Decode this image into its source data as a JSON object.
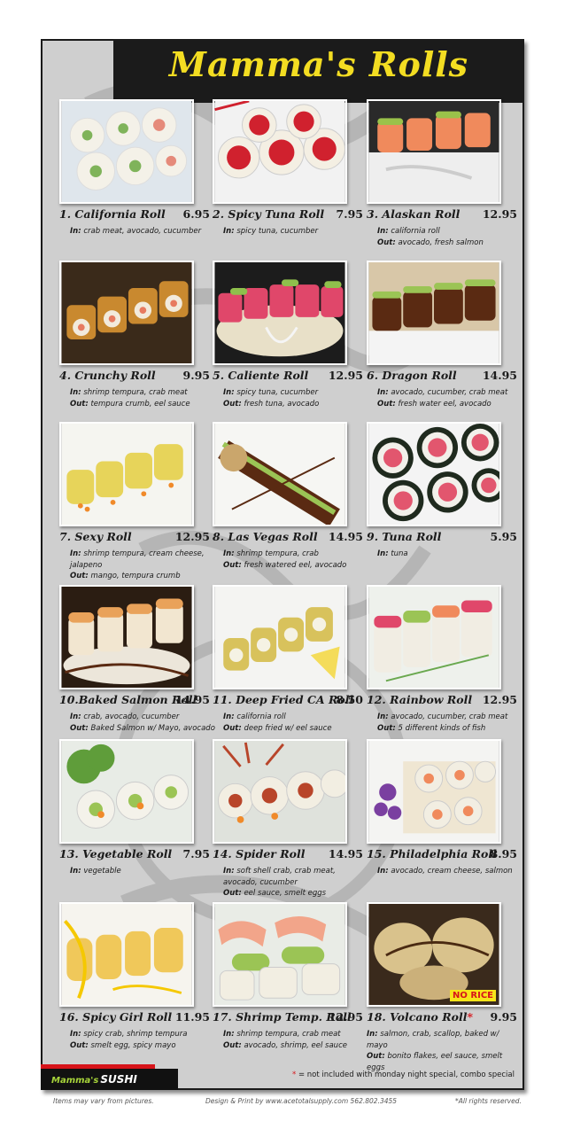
{
  "title": "Mamma's Rolls",
  "colors": {
    "title_yellow": "#f3dd22",
    "panel_gray": "#cfcfcf",
    "accent_red": "#d7141a",
    "logo_green": "#a7d43a"
  },
  "rolls": [
    {
      "name": "1. California Roll",
      "price": "6.95",
      "in_label": "In:",
      "in": "crab meat, avocado, cucumber",
      "out_label": "",
      "out": ""
    },
    {
      "name": "2. Spicy Tuna Roll",
      "price": "7.95",
      "in_label": "In:",
      "in": "spicy tuna, cucumber",
      "out_label": "",
      "out": ""
    },
    {
      "name": "3. Alaskan Roll",
      "price": "12.95",
      "in_label": "In:",
      "in": "california roll",
      "out_label": "Out:",
      "out": "avocado, fresh salmon"
    },
    {
      "name": "4. Crunchy Roll",
      "price": "9.95",
      "in_label": "In:",
      "in": "shrimp tempura, crab meat",
      "out_label": "Out:",
      "out": "tempura crumb, eel sauce"
    },
    {
      "name": "5. Caliente Roll",
      "price": "12.95",
      "in_label": "In:",
      "in": "spicy tuna, cucumber",
      "out_label": "Out:",
      "out": "fresh tuna, avocado"
    },
    {
      "name": "6. Dragon Roll",
      "price": "14.95",
      "in_label": "In:",
      "in": "avocado, cucumber, crab meat",
      "out_label": "Out:",
      "out": "fresh water eel, avocado"
    },
    {
      "name": "7. Sexy Roll",
      "price": "12.95",
      "in_label": "In:",
      "in": "shrimp tempura, cream cheese, jalapeno",
      "out_label": "Out:",
      "out": "mango, tempura crumb"
    },
    {
      "name": "8.  Las Vegas Roll",
      "price": "14.95",
      "in_label": "In:",
      "in": "shrimp tempura, crab",
      "out_label": "Out:",
      "out": "fresh watered eel, avocado"
    },
    {
      "name": "9. Tuna Roll",
      "price": "5.95",
      "in_label": "In:",
      "in": "tuna",
      "out_label": "",
      "out": ""
    },
    {
      "name": "10.Baked Salmon Roll",
      "price": "14.95",
      "in_label": "In:",
      "in": "crab, avocado, cucumber",
      "out_label": "Out:",
      "out": "Baked Salmon w/ Mayo, avocado"
    },
    {
      "name": "11. Deep Fried CA Roll",
      "price": "8.50",
      "in_label": "In:",
      "in": "california roll",
      "out_label": "Out:",
      "out": "deep fried w/ eel sauce"
    },
    {
      "name": "12. Rainbow Roll",
      "price": "12.95",
      "in_label": "In:",
      "in": "avocado, cucumber, crab meat",
      "out_label": "Out:",
      "out": "5 different kinds of fish"
    },
    {
      "name": "13. Vegetable Roll",
      "price": "7.95",
      "in_label": "In:",
      "in": "vegetable",
      "out_label": "",
      "out": ""
    },
    {
      "name": "14. Spider Roll",
      "price": "14.95",
      "in_label": "In:",
      "in": "soft shell crab, crab meat, avocado, cucumber",
      "out_label": "Out:",
      "out": "eel sauce, smelt eggs"
    },
    {
      "name": "15. Philadelphia Roll",
      "price": "8.95",
      "in_label": "In:",
      "in": "avocado, cream cheese, salmon",
      "out_label": "",
      "out": ""
    },
    {
      "name": "16. Spicy Girl Roll",
      "price": "11.95",
      "in_label": "In:",
      "in": "spicy crab, shrimp tempura",
      "out_label": "Out:",
      "out": "smelt egg, spicy mayo"
    },
    {
      "name": "17. Shrimp Temp. Roll",
      "price": "12.95",
      "in_label": "In:",
      "in": "shrimp tempura, crab meat",
      "out_label": "Out:",
      "out": "avocado, shrimp, eel sauce"
    },
    {
      "name": "18. Volcano Roll",
      "price": "9.95",
      "in_label": "In:",
      "in": "salmon, crab, scallop, baked w/ mayo",
      "out_label": "Out:",
      "out": "bonito flakes, eel sauce, smelt eggs"
    }
  ],
  "volcano_asterisk": "*",
  "no_rice_badge": "NO RICE",
  "logo": {
    "part1": "Mamma's",
    "part2": "SUSHI"
  },
  "note": {
    "asterisk": "*",
    "text": " = not included with monday night special, combo special"
  },
  "footer": {
    "left": "Items may vary from pictures.",
    "center": "Design  & Print  by www.acetotalsupply.com 562.802.3455",
    "right": "*All rights reserved."
  }
}
